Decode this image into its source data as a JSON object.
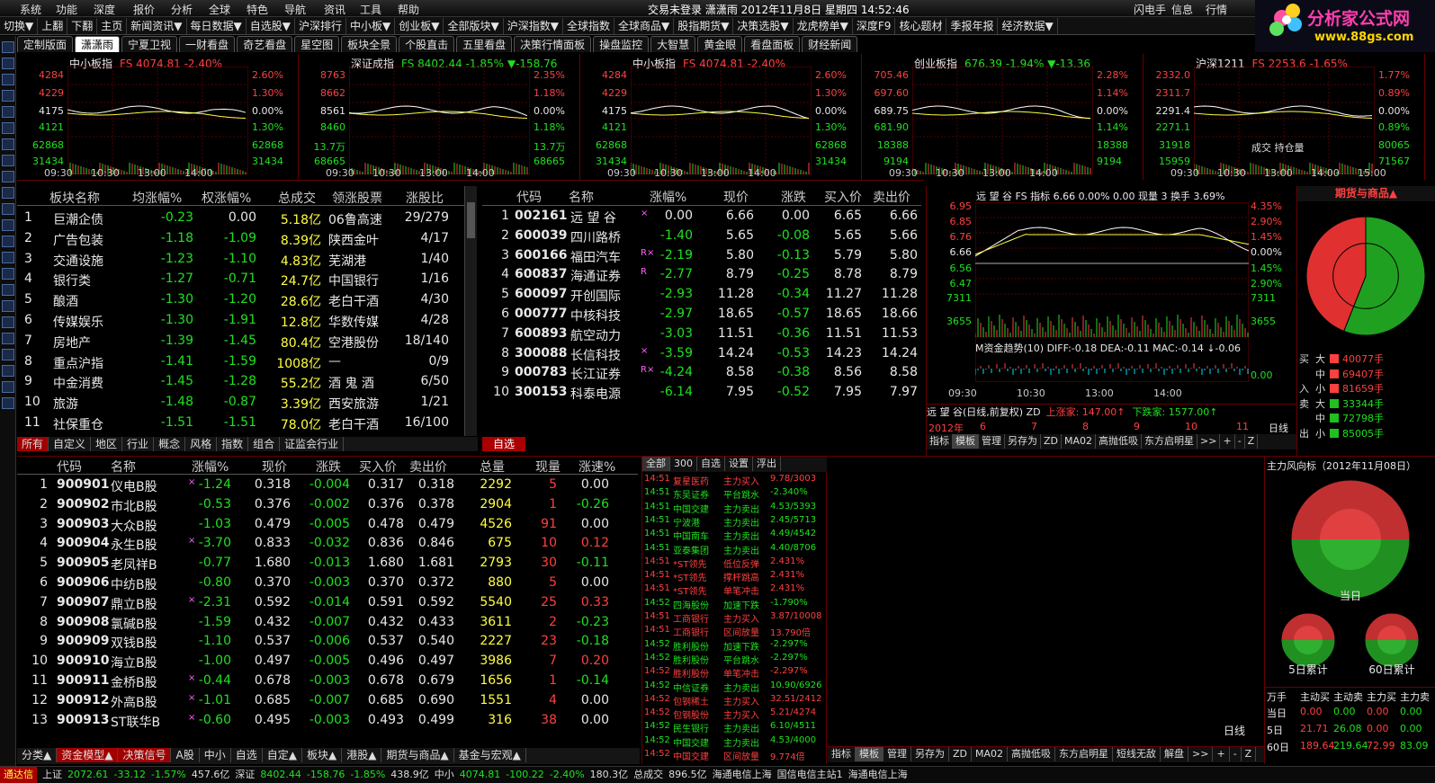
{
  "menu": [
    "系统",
    "功能",
    "深度",
    "报价",
    "分析",
    "全球",
    "特色",
    "导航",
    "资讯",
    "工具",
    "帮助"
  ],
  "title_center": "交易未登录   潇潇雨  2012年11月8日 星期四 14:52:46",
  "menu_right": [
    "闪电手",
    "信息",
    "行情"
  ],
  "toolbar": [
    "切换▼",
    "上翻",
    "下翻",
    "主页",
    "新闻资讯▼",
    "每日数据▼",
    "自选股▼",
    "沪深排行",
    "中小板▼",
    "创业板▼",
    "全部版块▼",
    "沪深指数▼",
    "全球指数",
    "全球商品▼",
    "股指期货▼",
    "决策选股▼",
    "龙虎榜单▼",
    "深度F9",
    "核心题材",
    "季报年报",
    "经济数据▼"
  ],
  "logo": {
    "text": "分析家公式网",
    "url": "www.88gs.com"
  },
  "tabs": [
    "定制版面",
    "潇潇雨",
    "宁夏卫视",
    "一财看盘",
    "奇艺看盘",
    "星空图",
    "板块全景",
    "个股直击",
    "五里看盘",
    "决策行情面板",
    "操盘监控",
    "大智慧",
    "黄金眼",
    "看盘面板",
    "财经新闻"
  ],
  "minicharts": [
    {
      "name": "中小板指",
      "info": "FS 4074.81 -2.40%",
      "info_color": "#ff4040",
      "left": [
        "4284",
        "4229",
        "4175",
        "4121",
        "62868",
        "31434"
      ],
      "right": [
        "2.60%",
        "1.30%",
        "0.00%",
        "1.30%",
        "62868",
        "31434"
      ],
      "times": [
        "09:30",
        "10:30",
        "13:00",
        "14:00"
      ]
    },
    {
      "name": "深证成指",
      "info": "FS 8402.44 -1.85% ▼-158.76",
      "info_color": "#20e020",
      "left": [
        "8763",
        "8662",
        "8561",
        "8460",
        "13.7万",
        "68665"
      ],
      "right": [
        "2.35%",
        "1.18%",
        "0.00%",
        "1.18%",
        "13.7万",
        "68665"
      ],
      "times": [
        "09:30",
        "10:30",
        "13:00",
        "14:00"
      ]
    },
    {
      "name": "中小板指",
      "info": "FS 4074.81 -2.40%",
      "info_color": "#ff4040",
      "left": [
        "4284",
        "4229",
        "4175",
        "4121",
        "62868",
        "31434"
      ],
      "right": [
        "2.60%",
        "1.30%",
        "0.00%",
        "1.30%",
        "62868",
        "31434"
      ],
      "times": [
        "09:30",
        "10:30",
        "13:00",
        "14:00"
      ]
    },
    {
      "name": "创业板指",
      "info": "676.39 -1.94% ▼-13.36",
      "info_color": "#20e020",
      "left": [
        "705.46",
        "697.60",
        "689.75",
        "681.90",
        "18388",
        "9194"
      ],
      "right": [
        "2.28%",
        "1.14%",
        "0.00%",
        "1.14%",
        "18388",
        "9194"
      ],
      "times": [
        "09:30",
        "10:30",
        "13:00",
        "14:00"
      ]
    },
    {
      "name": "沪深1211",
      "info": "FS 2253.6 -1.65%",
      "info_color": "#ff4040",
      "left": [
        "2332.0",
        "2311.7",
        "2291.4",
        "2271.1",
        "31918",
        "15959"
      ],
      "right": [
        "1.77%",
        "0.89%",
        "0.00%",
        "0.89%",
        "80065",
        "71567"
      ],
      "times": [
        "09:30",
        "10:30",
        "13:00",
        "14:00",
        "15:00"
      ],
      "extra": "成交 持仓量"
    }
  ],
  "sectors": {
    "headers": [
      "板块名称",
      "均涨幅%",
      "权涨幅%",
      "总成交",
      "领涨股票",
      "涨股比"
    ],
    "rows": [
      [
        "1",
        "巨潮企债",
        "-0.23",
        "0.00",
        "5.18亿",
        "06鲁高速",
        "29/279"
      ],
      [
        "2",
        "广告包装",
        "-1.18",
        "-1.09",
        "8.39亿",
        "陕西金叶",
        "4/17"
      ],
      [
        "3",
        "交通设施",
        "-1.23",
        "-1.10",
        "4.83亿",
        "芜湖港",
        "1/40"
      ],
      [
        "4",
        "银行类",
        "-1.27",
        "-0.71",
        "24.7亿",
        "中国银行",
        "1/16"
      ],
      [
        "5",
        "酿酒",
        "-1.30",
        "-1.20",
        "28.6亿",
        "老白干酒",
        "4/30"
      ],
      [
        "6",
        "传媒娱乐",
        "-1.30",
        "-1.91",
        "12.8亿",
        "华数传媒",
        "4/28"
      ],
      [
        "7",
        "房地产",
        "-1.39",
        "-1.45",
        "80.4亿",
        "空港股份",
        "18/140"
      ],
      [
        "8",
        "重点沪指",
        "-1.41",
        "-1.59",
        "1008亿",
        "—",
        "0/9"
      ],
      [
        "9",
        "中金消费",
        "-1.45",
        "-1.28",
        "55.2亿",
        "酒 鬼 酒",
        "6/50"
      ],
      [
        "10",
        "旅游",
        "-1.48",
        "-0.87",
        "3.39亿",
        "西安旅游",
        "1/21"
      ],
      [
        "11",
        "社保重仓",
        "-1.51",
        "-1.51",
        "78.0亿",
        "老白干酒",
        "16/100"
      ]
    ],
    "tabs": [
      "所有",
      "自定义",
      "地区",
      "行业",
      "概念",
      "风格",
      "指数",
      "组合",
      "证监会行业"
    ]
  },
  "watchlist": {
    "headers": [
      "代码",
      "名称",
      "涨幅%",
      "现价",
      "涨跌",
      "买入价",
      "卖出价"
    ],
    "rows": [
      [
        "1",
        "002161",
        "远 望 谷",
        "×",
        "0.00",
        "6.66",
        "0.00",
        "6.65",
        "6.66"
      ],
      [
        "2",
        "600039",
        "四川路桥",
        "",
        "-1.40",
        "5.65",
        "-0.08",
        "5.65",
        "5.66"
      ],
      [
        "3",
        "600166",
        "福田汽车",
        "R×",
        "-2.19",
        "5.80",
        "-0.13",
        "5.79",
        "5.80"
      ],
      [
        "4",
        "600837",
        "海通证券",
        "R",
        "-2.77",
        "8.79",
        "-0.25",
        "8.78",
        "8.79"
      ],
      [
        "5",
        "600097",
        "开创国际",
        "",
        "-2.93",
        "11.28",
        "-0.34",
        "11.27",
        "11.28"
      ],
      [
        "6",
        "000777",
        "中核科技",
        "",
        "-2.97",
        "18.65",
        "-0.57",
        "18.65",
        "18.66"
      ],
      [
        "7",
        "600893",
        "航空动力",
        "",
        "-3.03",
        "11.51",
        "-0.36",
        "11.51",
        "11.53"
      ],
      [
        "8",
        "300088",
        "长信科技",
        "×",
        "-3.59",
        "14.24",
        "-0.53",
        "14.23",
        "14.24"
      ],
      [
        "9",
        "000783",
        "长江证券",
        "R×",
        "-4.24",
        "8.58",
        "-0.38",
        "8.56",
        "8.58"
      ],
      [
        "10",
        "300153",
        "科泰电源",
        "",
        "-6.14",
        "7.95",
        "-0.52",
        "7.95",
        "7.97"
      ]
    ],
    "tab": "自选"
  },
  "stockchart": {
    "title": "远 望 谷  FS 指标 6.66 0.00%  0.00 现量 3 换手 3.69%",
    "left": [
      "6.95",
      "6.85",
      "6.76",
      "6.66",
      "6.56",
      "6.47",
      "7311",
      "3655"
    ],
    "right": [
      "4.35%",
      "2.90%",
      "1.45%",
      "0.00%",
      "1.45%",
      "2.90%",
      "7311",
      "3655",
      "0.00"
    ],
    "macd": "M资金趋势(10)  DIFF:-0.18  DEA:-0.11  MAC:-0.14  ↓-0.06",
    "times": [
      "09:30",
      "10:30",
      "13:00",
      "14:00"
    ],
    "kline_title": "远 望 谷(日线,前复权) ZD",
    "up_text": "上涨家: 147.00↑",
    "down_text": "下跌家: 1577.00↑",
    "kline_axis": [
      "2012年",
      "6",
      "7",
      "8",
      "9",
      "10",
      "11"
    ],
    "kline_period": "日线",
    "bottom": [
      "指标",
      "模板",
      "管理",
      "另存为",
      "ZD",
      "MA02",
      "高抛低吸",
      "东方启明星",
      ">>",
      "+",
      "-",
      "Z"
    ]
  },
  "fut": {
    "title": "期货与商品▲",
    "pie": [
      {
        "v": 0.56,
        "c": "#20a020"
      },
      {
        "v": 0.44,
        "c": "#e03030"
      }
    ],
    "flow": [
      [
        "买",
        "大",
        "40077手"
      ],
      [
        "",
        "中",
        "69407手"
      ],
      [
        "入",
        "小",
        "81659手"
      ],
      [
        "卖",
        "大",
        "33344手"
      ],
      [
        "",
        "中",
        "72798手"
      ],
      [
        "出",
        "小",
        "85005手"
      ]
    ]
  },
  "bshares": {
    "headers": [
      "代码",
      "名称",
      "涨幅%",
      "现价",
      "涨跌",
      "买入价",
      "卖出价",
      "总量",
      "现量",
      "涨速%"
    ],
    "rows": [
      [
        "1",
        "900901",
        "仪电B股",
        "×",
        "-1.24",
        "0.318",
        "-0.004",
        "0.317",
        "0.318",
        "2292",
        "5",
        "0.00"
      ],
      [
        "2",
        "900902",
        "市北B股",
        "",
        "-0.53",
        "0.376",
        "-0.002",
        "0.376",
        "0.378",
        "2904",
        "1",
        "-0.26"
      ],
      [
        "3",
        "900903",
        "大众B股",
        "",
        "-1.03",
        "0.479",
        "-0.005",
        "0.478",
        "0.479",
        "4526",
        "91",
        "0.00"
      ],
      [
        "4",
        "900904",
        "永生B股",
        "×",
        "-3.70",
        "0.833",
        "-0.032",
        "0.836",
        "0.846",
        "675",
        "10",
        "0.12"
      ],
      [
        "5",
        "900905",
        "老凤祥B",
        "",
        "-0.77",
        "1.680",
        "-0.013",
        "1.680",
        "1.681",
        "2793",
        "30",
        "-0.11"
      ],
      [
        "6",
        "900906",
        "中纺B股",
        "",
        "-0.80",
        "0.370",
        "-0.003",
        "0.370",
        "0.372",
        "880",
        "5",
        "0.00"
      ],
      [
        "7",
        "900907",
        "鼎立B股",
        "×",
        "-2.31",
        "0.592",
        "-0.014",
        "0.591",
        "0.592",
        "5540",
        "25",
        "0.33"
      ],
      [
        "8",
        "900908",
        "氯碱B股",
        "",
        "-1.59",
        "0.432",
        "-0.007",
        "0.432",
        "0.433",
        "3611",
        "2",
        "-0.23"
      ],
      [
        "9",
        "900909",
        "双钱B股",
        "",
        "-1.10",
        "0.537",
        "-0.006",
        "0.537",
        "0.540",
        "2227",
        "23",
        "-0.18"
      ],
      [
        "10",
        "900910",
        "海立B股",
        "",
        "-1.00",
        "0.497",
        "-0.005",
        "0.496",
        "0.497",
        "3986",
        "7",
        "0.20"
      ],
      [
        "11",
        "900911",
        "金桥B股",
        "×",
        "-0.44",
        "0.678",
        "-0.003",
        "0.678",
        "0.679",
        "1656",
        "1",
        "-0.14"
      ],
      [
        "12",
        "900912",
        "外高B股",
        "×",
        "-1.01",
        "0.685",
        "-0.007",
        "0.685",
        "0.690",
        "1551",
        "4",
        "0.00"
      ],
      [
        "13",
        "900913",
        "ST联华B",
        "×",
        "-0.60",
        "0.495",
        "-0.003",
        "0.493",
        "0.499",
        "316",
        "38",
        "0.00"
      ]
    ],
    "tabs": [
      "分类▲",
      "资金模型▲",
      "决策信号",
      "A股",
      "中小",
      "自选",
      "自定▲",
      "板块▲",
      "港股▲",
      "期货与商品▲",
      "基金与宏观▲"
    ]
  },
  "radar": {
    "tabs": [
      "全部",
      "300",
      "自选",
      "设置",
      "浮出"
    ],
    "rows": [
      [
        "14:51",
        "复星医药",
        "主力买入",
        "9.78/3003"
      ],
      [
        "14:51",
        "东吴证券",
        "平台跳水",
        "-2.340%"
      ],
      [
        "14:51",
        "中国交建",
        "主力卖出",
        "4.53/5393"
      ],
      [
        "14:51",
        "宁波港",
        "主力卖出",
        "2.45/5713"
      ],
      [
        "14:51",
        "中国南车",
        "主力卖出",
        "4.49/4542"
      ],
      [
        "14:51",
        "亚泰集团",
        "主力卖出",
        "4.40/8706"
      ],
      [
        "14:51",
        "*ST领先",
        "低位反弹",
        "2.431%"
      ],
      [
        "14:51",
        "*ST领先",
        "撑杆跳高",
        "2.431%"
      ],
      [
        "14:51",
        "*ST领先",
        "单笔冲击",
        "2.431%"
      ],
      [
        "14:52",
        "四海股份",
        "加速下跌",
        "-1.790%"
      ],
      [
        "14:51",
        "工商银行",
        "主力买入",
        "3.87/10008"
      ],
      [
        "14:51",
        "工商银行",
        "区间放量",
        "13.790倍"
      ],
      [
        "14:52",
        "胜利股份",
        "加速下跌",
        "-2.297%"
      ],
      [
        "14:52",
        "胜利股份",
        "平台跳水",
        "-2.297%"
      ],
      [
        "14:52",
        "胜利股份",
        "单笔冲击",
        "-2.297%"
      ],
      [
        "14:52",
        "中信证券",
        "主力卖出",
        "10.90/6926"
      ],
      [
        "14:52",
        "包钢稀土",
        "主力买入",
        "32.51/2412"
      ],
      [
        "14:52",
        "包钢股份",
        "主力买入",
        "5.21/4274"
      ],
      [
        "14:52",
        "民生银行",
        "主力卖出",
        "6.10/4511"
      ],
      [
        "14:52",
        "中国交建",
        "主力卖出",
        "4.53/4000"
      ],
      [
        "14:52",
        "中国交建",
        "区间放量",
        "9.774倍"
      ]
    ]
  },
  "bottom_tool": {
    "period": "日线",
    "items": [
      "指标",
      "模板",
      "管理",
      "另存为",
      "ZD",
      "MA02",
      "高抛低吸",
      "东方启明星",
      "短线无敌",
      "解盘",
      ">>",
      "+",
      "-",
      "Z"
    ]
  },
  "force": {
    "title": "主力风向标（2012年11月08日）",
    "labels": [
      "当日",
      "5日累计",
      "60日累计"
    ],
    "head": [
      "万手",
      "主动买",
      "主动卖",
      "主力买",
      "主力卖"
    ],
    "rows": [
      [
        "当日",
        "0.00",
        "0.00",
        "0.00",
        "0.00"
      ],
      [
        "5日",
        "21.71",
        "26.08",
        "0.00",
        "0.00"
      ],
      [
        "60日",
        "189.64",
        "219.64",
        "72.99",
        "83.09"
      ]
    ]
  },
  "status": [
    {
      "t": "通达信",
      "c": "#ffff40"
    },
    {
      "t": "上证",
      "c": "#ddd"
    },
    {
      "t": "2072.61",
      "c": "#20e020"
    },
    {
      "t": "-33.12",
      "c": "#20e020"
    },
    {
      "t": "-1.57%",
      "c": "#20e020"
    },
    {
      "t": "457.6亿",
      "c": "#ddd"
    },
    {
      "t": "深证",
      "c": "#ddd"
    },
    {
      "t": "8402.44",
      "c": "#20e020"
    },
    {
      "t": "-158.76",
      "c": "#20e020"
    },
    {
      "t": "-1.85%",
      "c": "#20e020"
    },
    {
      "t": "438.9亿",
      "c": "#ddd"
    },
    {
      "t": "中小",
      "c": "#ddd"
    },
    {
      "t": "4074.81",
      "c": "#20e020"
    },
    {
      "t": "-100.22",
      "c": "#20e020"
    },
    {
      "t": "-2.40%",
      "c": "#20e020"
    },
    {
      "t": "180.3亿",
      "c": "#ddd"
    },
    {
      "t": "总成交",
      "c": "#ddd"
    },
    {
      "t": "896.5亿",
      "c": "#ddd"
    },
    {
      "t": "海通电信上海",
      "c": "#ddd"
    },
    {
      "t": "国信电信主站1",
      "c": "#ddd"
    },
    {
      "t": "海通电信上海",
      "c": "#ddd"
    }
  ]
}
